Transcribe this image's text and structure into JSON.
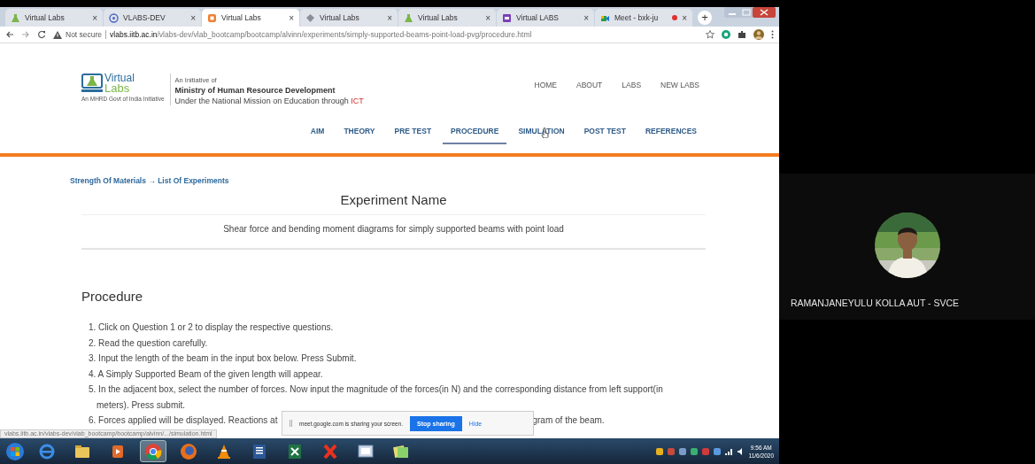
{
  "browser": {
    "tabs": [
      {
        "title": "Virtual Labs",
        "selected": false
      },
      {
        "title": "VLABS-DEV",
        "selected": false
      },
      {
        "title": "Virtual Labs",
        "selected": true
      },
      {
        "title": "Virtual Labs",
        "selected": false
      },
      {
        "title": "Virtual Labs",
        "selected": false
      },
      {
        "title": "Virtual LABS",
        "selected": false
      },
      {
        "title": "Meet - bxk-ju",
        "selected": false,
        "recording": true
      }
    ],
    "close_glyph": "×",
    "new_tab": "+",
    "address": {
      "security": "Not secure",
      "host": "vlabs.iitb.ac.in",
      "path": "/vlabs-dev/vlab_bootcamp/bootcamp/alvinn/experiments/simply-supported-beams-point-load-pvg/procedure.html"
    }
  },
  "page": {
    "logo": {
      "line1": "Virtual",
      "line2": "Labs",
      "tagline": "An MHRD Govt of India Initiative"
    },
    "initiative": {
      "intro": "An Initiative of",
      "ministry": "Ministry of Human Resource Development",
      "mission": "Under the National Mission on Education through",
      "mission_highlight": "ICT"
    },
    "top_nav": [
      "HOME",
      "ABOUT",
      "LABS",
      "NEW LABS"
    ],
    "sections": [
      {
        "label": "AIM",
        "selected": false
      },
      {
        "label": "THEORY",
        "selected": false
      },
      {
        "label": "PRE TEST",
        "selected": false
      },
      {
        "label": "PROCEDURE",
        "selected": true
      },
      {
        "label": "SIMULATION",
        "selected": false
      },
      {
        "label": "POST TEST",
        "selected": false
      },
      {
        "label": "REFERENCES",
        "selected": false
      }
    ],
    "breadcrumb": "Strength Of Materials → List Of Experiments",
    "experiment_heading": "Experiment Name",
    "experiment_name": "Shear force and bending moment diagrams for simply supported beams with point load",
    "procedure_heading": "Procedure",
    "steps": [
      {
        "kind": "text",
        "text": "1. Click on Question 1 or 2 to display the respective questions."
      },
      {
        "kind": "text",
        "text": "2. Read the question carefully."
      },
      {
        "kind": "text",
        "text": "3. Input the length of the beam in the input box below. Press Submit."
      },
      {
        "kind": "text",
        "text": "4. A Simply Supported Beam of the given length will appear."
      },
      {
        "kind": "text",
        "text": "5. In the adjacent box, select the number of forces. Now input the magnitude of the forces(in N) and the corresponding distance from left support(in meters). Press submit."
      },
      {
        "kind": "split",
        "parts": [
          "6. Forces applied will be displayed. Reactions at",
          "gram of the beam."
        ]
      }
    ],
    "status_url": "vlabs.iitb.ac.in/vlabs-dev/vlab_bootcamp/bootcamp/alvinn/.../simulation.html",
    "share_bar": {
      "message": "meet.google.com is sharing your screen.",
      "stop": "Stop sharing",
      "hide": "Hide"
    }
  },
  "taskbar": {
    "apps": [
      {
        "selected": false
      },
      {
        "selected": false
      },
      {
        "selected": false
      },
      {
        "selected": true
      },
      {
        "selected": false
      },
      {
        "selected": false
      },
      {
        "selected": false
      },
      {
        "selected": false
      },
      {
        "selected": false
      },
      {
        "selected": false
      },
      {
        "selected": false
      }
    ],
    "time": "9:56 AM",
    "date": "11/6/2020"
  },
  "meet": {
    "participant": {
      "name": "RAMANJANEYULU KOLLA AUT - SVCE"
    }
  }
}
